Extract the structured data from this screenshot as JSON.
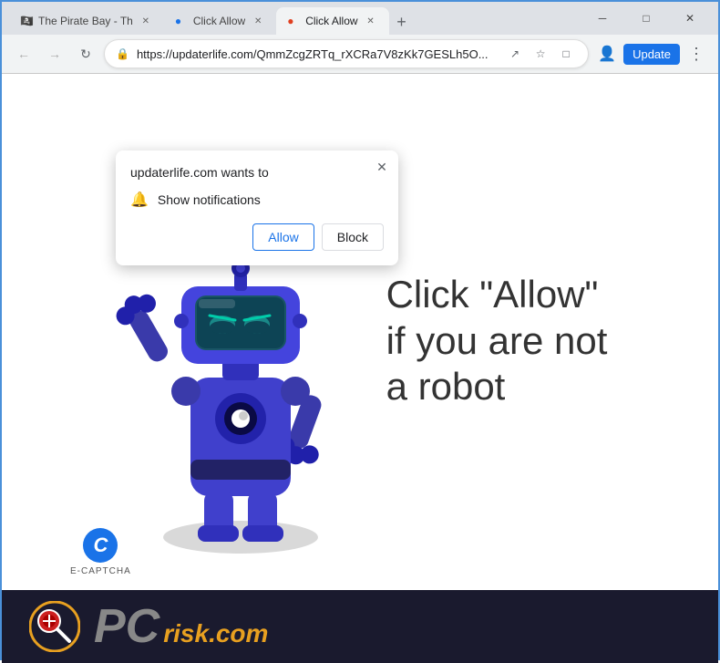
{
  "browser": {
    "tabs": [
      {
        "id": "tab1",
        "favicon": "🏴‍☠️",
        "title": "The Pirate Bay - Th",
        "active": false
      },
      {
        "id": "tab2",
        "favicon": "🔵",
        "title": "Click Allow",
        "active": false
      },
      {
        "id": "tab3",
        "favicon": "🔴",
        "title": "Click Allow",
        "active": true
      }
    ],
    "url": "https://updaterlife.com/QmmZcgZRTq_rXCRa7V8zKk7GESLh5O...",
    "update_label": "Update",
    "window_controls": {
      "minimize": "─",
      "maximize": "□",
      "close": "✕"
    }
  },
  "notification_popup": {
    "title": "updaterlife.com wants to",
    "permission_text": "Show notifications",
    "allow_label": "Allow",
    "block_label": "Block"
  },
  "main_content": {
    "robot_text_line1": "Click \"Allow\"",
    "robot_text_line2": "if you are not",
    "robot_text_line3": "a robot"
  },
  "captcha": {
    "label": "E-CAPTCHA"
  },
  "bottom_banner": {
    "pc_text": "PC",
    "risk_text": "risk.com"
  }
}
